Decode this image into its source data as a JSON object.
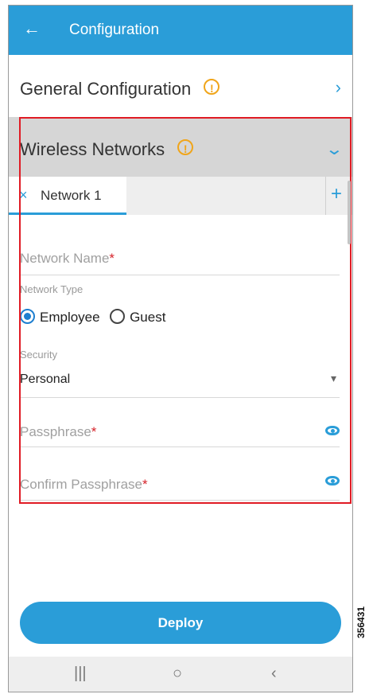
{
  "appbar": {
    "back_icon": "←",
    "title": "Configuration"
  },
  "sections": {
    "general": {
      "label": "General Configuration",
      "warn_icon": "!",
      "chevron_icon": "›"
    },
    "wireless": {
      "label": "Wireless Networks",
      "warn_icon": "!",
      "chevron_icon": "⌄"
    }
  },
  "tabs": {
    "items": [
      {
        "close_icon": "×",
        "label": "Network 1"
      }
    ],
    "add_icon": "+"
  },
  "form": {
    "network_name": {
      "placeholder": "Network Name",
      "required_mark": "*"
    },
    "network_type": {
      "label": "Network Type",
      "options": [
        {
          "label": "Employee",
          "selected": true
        },
        {
          "label": "Guest",
          "selected": false
        }
      ]
    },
    "security": {
      "label": "Security",
      "value": "Personal",
      "dropdown_icon": "▾"
    },
    "passphrase": {
      "placeholder": "Passphrase",
      "required_mark": "*"
    },
    "confirm_passphrase": {
      "placeholder": "Confirm Passphrase",
      "required_mark": "*"
    }
  },
  "deploy_label": "Deploy",
  "navbar": {
    "recents_icon": "|||",
    "home_icon": "○",
    "back_icon": "‹"
  },
  "figure_id": "356431",
  "colors": {
    "accent": "#2a9dd8",
    "warning": "#f0a51a",
    "required": "#d6232a",
    "highlight_box": "#e01b24"
  }
}
